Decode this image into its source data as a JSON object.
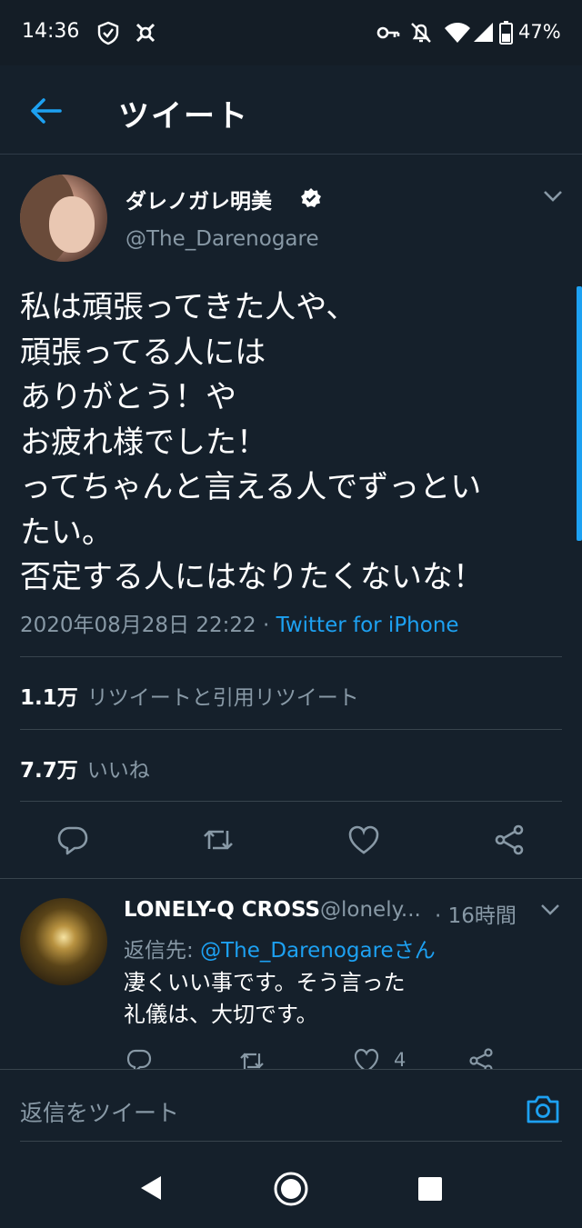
{
  "status_bar": {
    "time": "14:36",
    "battery": "47%"
  },
  "header": {
    "title": "ツイート"
  },
  "tweet": {
    "author_name": "ダレノガレ明美",
    "author_handle": "@The_Darenogare",
    "text": "私は頑張ってきた人や、\n頑張ってる人には\nありがとう！や\nお疲れ様でした！\nってちゃんと言える人でずっとい\nたい。\n否定する人にはなりたくないな！",
    "timestamp": "2020年08月28日 22:22 · ",
    "source": "Twitter for iPhone",
    "retweets_count": "1.1万",
    "retweets_label": "リツイートと引用リツイート",
    "likes_count": "7.7万",
    "likes_label": "いいね"
  },
  "reply": {
    "name": "LONELY-Q CROSS",
    "handle": "@lonely...",
    "time": "· 16時間",
    "reply_to_prefix": "返信先: ",
    "reply_to_mention": "@The_Darenogareさん",
    "text": "凄くいい事です。そう言った\n礼儀は、大切です。",
    "like_count": "4"
  },
  "compose": {
    "placeholder": "返信をツイート"
  },
  "colors": {
    "background": "#15202b",
    "accent": "#1da1f2",
    "muted": "#8899a6",
    "divider": "#38444d"
  },
  "icons": [
    "back-arrow-icon",
    "verified-badge-icon",
    "chevron-down-icon",
    "reply-icon",
    "retweet-icon",
    "like-icon",
    "share-icon",
    "camera-icon"
  ]
}
